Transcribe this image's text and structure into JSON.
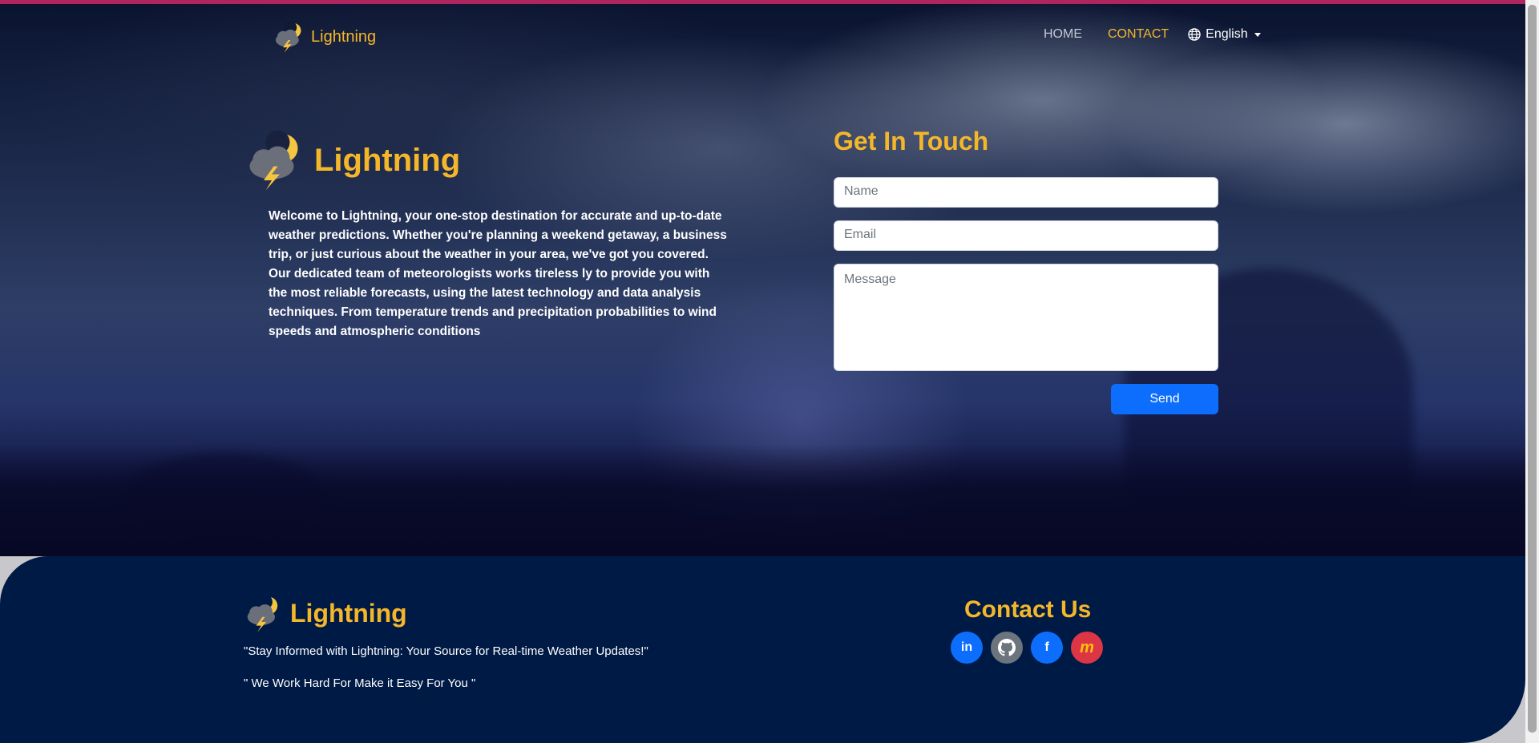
{
  "nav": {
    "brand": "Lightning",
    "links": [
      {
        "label": "HOME"
      },
      {
        "label": "CONTACT"
      }
    ],
    "language": "English"
  },
  "hero": {
    "title": "Lightning",
    "about": "Welcome to Lightning, your one-stop destination for accurate and up-to-date weather predictions. Whether you're planning a weekend getaway, a business trip, or just curious about the weather in your area, we've got you covered. Our dedicated team of meteorologists works tireless ly to provide you with the most reliable forecasts, using the latest technology and data analysis techniques. From temperature trends and precipitation probabilities to wind speeds and atmospheric conditions"
  },
  "form": {
    "title": "Get In Touch",
    "name_placeholder": "Name",
    "email_placeholder": "Email",
    "message_placeholder": "Message",
    "send_label": "Send"
  },
  "footer": {
    "brand": "Lightning",
    "quote1": "\"Stay Informed with Lightning: Your Source for Real-time Weather Updates!\"",
    "quote2": "\" We Work Hard For Make it Easy For You \"",
    "contact_title": "Contact Us",
    "socials": [
      {
        "icon": "linkedin-icon",
        "glyph": "in",
        "color": "#0d6efd"
      },
      {
        "icon": "github-icon",
        "glyph": "",
        "color": "#6c757d"
      },
      {
        "icon": "facebook-icon",
        "glyph": "f",
        "color": "#0d6efd"
      },
      {
        "icon": "m-icon",
        "glyph": "m",
        "color": "#dc3545"
      }
    ]
  },
  "colors": {
    "accent": "#f5b72a",
    "primary": "#0d6efd",
    "footer_bg": "#001a46"
  }
}
